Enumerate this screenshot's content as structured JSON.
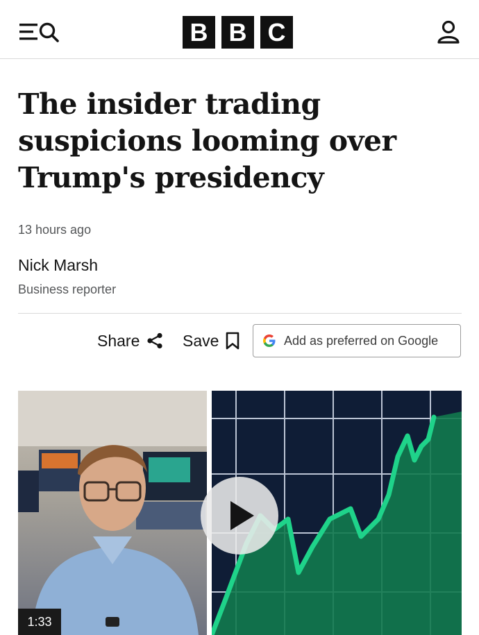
{
  "header": {
    "brand_letters": [
      "B",
      "B",
      "C"
    ],
    "menu_icon": "menu-icon",
    "search_icon": "search-icon",
    "account_icon": "account-icon"
  },
  "article": {
    "headline": "The insider trading suspicions looming over Trump's presidency",
    "timestamp": "13 hours ago",
    "author": "Nick Marsh",
    "author_role": "Business reporter"
  },
  "actions": {
    "share_label": "Share",
    "save_label": "Save",
    "google_label": "Add as preferred on Google"
  },
  "video": {
    "duration": "1:33",
    "play_icon": "play-icon"
  },
  "colors": {
    "chart_green": "#1fd38a",
    "chart_background": "#0f1d36"
  }
}
